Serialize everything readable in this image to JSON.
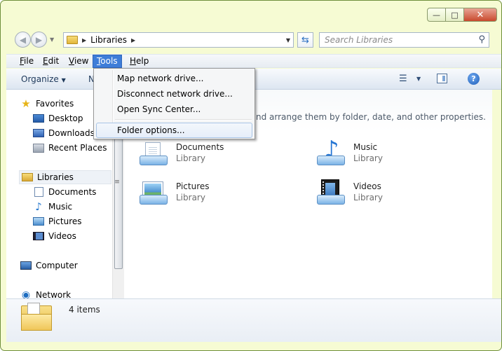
{
  "address": {
    "location": "Libraries"
  },
  "search": {
    "placeholder": "Search Libraries"
  },
  "menubar": {
    "items": [
      {
        "label": "File",
        "accel": "F"
      },
      {
        "label": "Edit",
        "accel": "E"
      },
      {
        "label": "View",
        "accel": "V"
      },
      {
        "label": "Tools",
        "accel": "T"
      },
      {
        "label": "Help",
        "accel": "H"
      }
    ],
    "open_menu": "Tools"
  },
  "toolbar": {
    "organize_label": "Organize",
    "new_label_partial": "N"
  },
  "tools_menu": {
    "items": [
      "Map network drive...",
      "Disconnect network drive...",
      "Open Sync Center...",
      "Folder options..."
    ],
    "highlighted": "Folder options..."
  },
  "nav_pane": {
    "favorites": {
      "label": "Favorites",
      "items": [
        "Desktop",
        "Downloads",
        "Recent Places"
      ]
    },
    "libraries": {
      "label": "Libraries",
      "items": [
        "Documents",
        "Music",
        "Pictures",
        "Videos"
      ]
    },
    "computer": {
      "label": "Computer"
    },
    "network": {
      "label": "Network"
    }
  },
  "content": {
    "description_partial": "nd arrange them by folder, date, and other properties.",
    "libraries": [
      {
        "name": "Documents",
        "type": "Library",
        "icon": "documents-library-icon"
      },
      {
        "name": "Music",
        "type": "Library",
        "icon": "music-library-icon"
      },
      {
        "name": "Pictures",
        "type": "Library",
        "icon": "pictures-library-icon"
      },
      {
        "name": "Videos",
        "type": "Library",
        "icon": "videos-library-icon"
      }
    ]
  },
  "details": {
    "count_text": "4 items"
  },
  "colors": {
    "frame": "#f6fbd3",
    "menu_active": "#3e7dd8",
    "close_button": "#c94a2e",
    "link_text": "#1e395b"
  }
}
